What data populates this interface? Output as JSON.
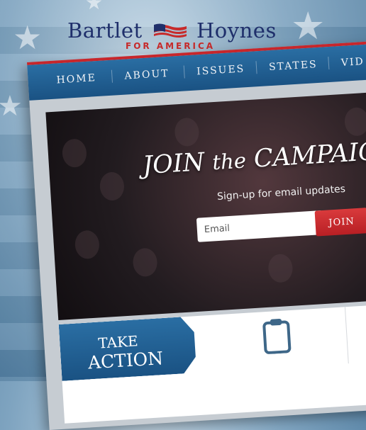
{
  "brand": {
    "left_name": "Bartlet",
    "right_name": "Hoynes",
    "tagline": "FOR AMERICA",
    "icon": "american-flag-icon"
  },
  "nav": {
    "items": [
      {
        "label": "HOME"
      },
      {
        "label": "ABOUT"
      },
      {
        "label": "ISSUES"
      },
      {
        "label": "STATES"
      },
      {
        "label": "VID"
      }
    ]
  },
  "hero": {
    "title_part1": "JOIN",
    "title_part2": "the",
    "title_part3": "CAMPAIG",
    "subtitle": "Sign-up for email updates",
    "email_placeholder": "Email",
    "join_label": "JOIN"
  },
  "take_action": {
    "line1": "TAKE",
    "line2": "ACTION",
    "icon": "clipboard-icon"
  },
  "colors": {
    "navy": "#1f2f6b",
    "red": "#c72a2a",
    "nav_blue": "#1a5283",
    "join_red": "#c7262b"
  }
}
